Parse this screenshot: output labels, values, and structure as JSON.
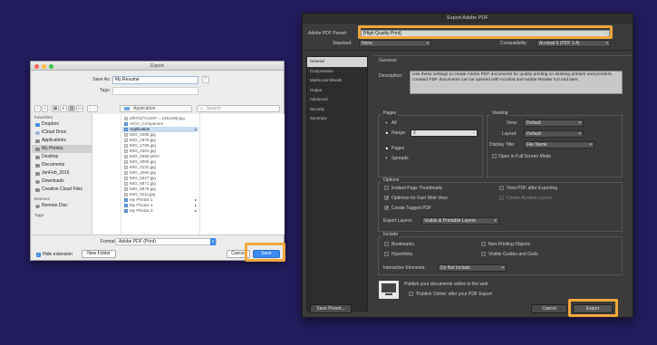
{
  "mac": {
    "title": "Export",
    "save_as_label": "Save As:",
    "save_as_value": "My Resume",
    "tags_label": "Tags:",
    "location": "Application",
    "search_placeholder": "Search",
    "sidebar": {
      "favorites_header": "Favorites",
      "favorites": [
        "Dropbox",
        "iCloud Drive",
        "Applications",
        "My Photos",
        "Desktop",
        "Documents",
        "JenFeb_2016",
        "Downloads",
        "Creative Cloud Files"
      ],
      "devices_header": "Devices",
      "devices": [
        "Remote Disc"
      ],
      "tags_header": "Tags"
    },
    "files": [
      "af9751f7c2e97....1381e8d.jpg",
      "AIGA_Companies",
      "Application",
      "IMG_0288.jpg",
      "IMG_1879.jpg",
      "IMG_1789.jpg",
      "IMG_2481.jpg",
      "IMG_2658.MOV",
      "IMG_3005.jpg",
      "IMG_3131.jpg",
      "IMG_4094.jpg",
      "IMG_5327.jpg",
      "IMG_6871.jpg",
      "IMG_6879.jpg",
      "IMG_9111.jpg",
      "My Photos 1",
      "My Photos 2",
      "My Photos 3"
    ],
    "format_label": "Format:",
    "format_value": "Adobe PDF (Print)",
    "hide_extension": "Hide extension",
    "new_folder": "New Folder",
    "cancel": "Cancel",
    "save": "Save"
  },
  "adobe": {
    "title": "Export Adobe PDF",
    "preset_label": "Adobe PDF Preset:",
    "preset_value": "[High Quality Print]",
    "standard_label": "Standard:",
    "standard_value": "None",
    "compat_label": "Compatibility:",
    "compat_value": "Acrobat 5 (PDF 1.4)",
    "categories": [
      "General",
      "Compression",
      "Marks and Bleeds",
      "Output",
      "Advanced",
      "Security",
      "Summary"
    ],
    "section_title": "General",
    "description_label": "Description:",
    "description": "Use these settings to create Adobe PDF documents for quality printing on desktop printers and proofers.  Created PDF documents can be opened with Acrobat and Adobe Reader 5.0 and later.",
    "pages": {
      "title": "Pages",
      "all": "All",
      "range": "Range:",
      "range_value": "2",
      "pages": "Pages",
      "spreads": "Spreads"
    },
    "viewing": {
      "title": "Viewing",
      "view_label": "View:",
      "view_value": "Default",
      "layout_label": "Layout:",
      "layout_value": "Default",
      "display_label": "Display Title:",
      "display_value": "File Name",
      "fullscreen": "Open in Full Screen Mode"
    },
    "options": {
      "title": "Options",
      "embed": "Embed Page Thumbnails",
      "optimize": "Optimize for Fast Web View",
      "tagged": "Create Tagged PDF",
      "view_after": "View PDF after Exporting",
      "acrobat_layers": "Create Acrobat Layers",
      "export_layers_label": "Export Layers:",
      "export_layers_value": "Visible & Printable Layers"
    },
    "include": {
      "title": "Include",
      "bookmarks": "Bookmarks",
      "hyperlinks": "Hyperlinks",
      "non_printing": "Non-Printing Objects",
      "guides": "Visible Guides and Grids",
      "interactive_label": "Interactive Elements:",
      "interactive_value": "Do Not Include"
    },
    "publish_text": "Publish your documents online to the web",
    "publish_check": "'Publish Online' after your PDF Export",
    "save_preset": "Save Preset...",
    "cancel": "Cancel",
    "export": "Export"
  },
  "colors": {
    "background": "#231c5e",
    "highlight": "#f2a73b",
    "mac_save": "#3b8cf0"
  }
}
